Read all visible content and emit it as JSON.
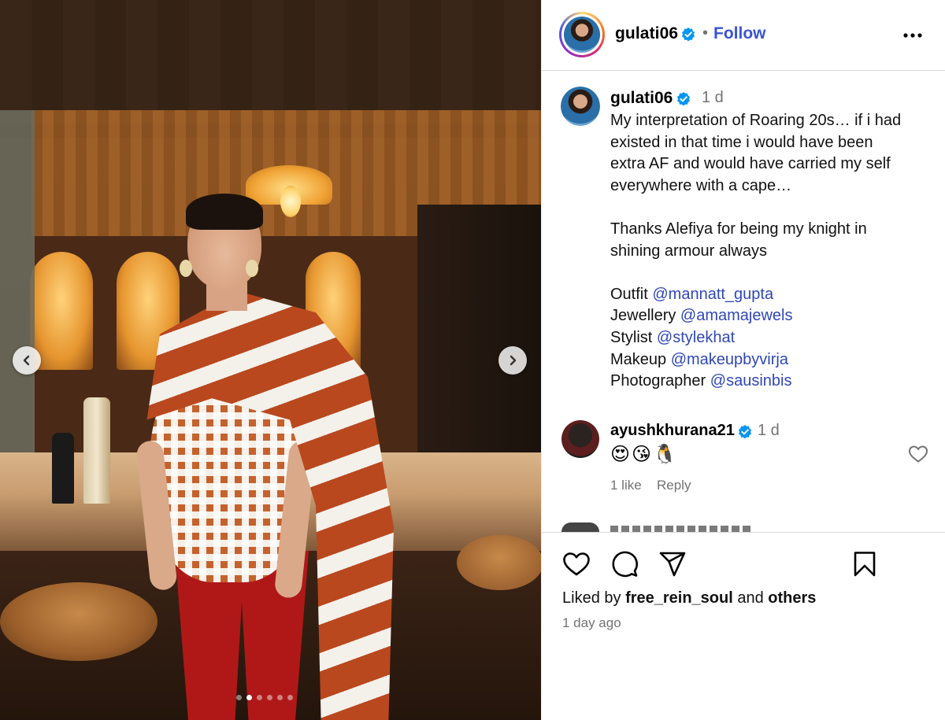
{
  "post": {
    "username": "gulati06",
    "follow_label": "Follow",
    "separator": "•",
    "caption_time": "1 d",
    "caption_lines": [
      "My interpretation of Roaring 20s… if i had",
      "existed in that time i would have been",
      "extra AF and would have carried my self",
      "everywhere with a cape…"
    ],
    "thanks_lines": [
      "Thanks Alefiya for being my knight in",
      "shining armour always"
    ],
    "credits": [
      {
        "role": "Outfit",
        "handle": "@mannatt_gupta"
      },
      {
        "role": "Jewellery",
        "handle": "@amamajewels"
      },
      {
        "role": "Stylist",
        "handle": "@stylekhat"
      },
      {
        "role": "Makeup",
        "handle": "@makeupbyvirja"
      },
      {
        "role": "Photographer",
        "handle": "@sausinbis"
      }
    ]
  },
  "comment": {
    "username": "ayushkhurana21",
    "time": "1 d",
    "emojis": "😍😘🐧",
    "likes": "1 like",
    "reply_label": "Reply"
  },
  "footer": {
    "liked_prefix": "Liked by",
    "liked_user": "free_rein_soul",
    "liked_and": "and",
    "liked_others": "others",
    "time_ago": "1 day ago"
  },
  "carousel": {
    "total_slides": 6,
    "active_index": 1
  },
  "icons": {
    "verified": "verified-badge-icon",
    "more": "more-options-icon",
    "prev": "chevron-left-icon",
    "next": "chevron-right-icon",
    "like": "heart-icon",
    "comment": "comment-bubble-icon",
    "share": "send-icon",
    "save": "bookmark-icon"
  },
  "colors": {
    "link": "#3047b8",
    "follow": "#3854d6",
    "verified": "#0095f6",
    "muted": "#737373"
  }
}
